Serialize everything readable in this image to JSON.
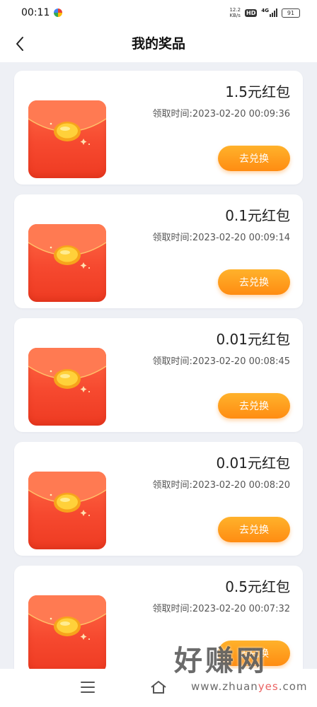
{
  "status_bar": {
    "time": "00:11",
    "net_speed_value": "12.2",
    "net_speed_unit": "KB/s",
    "hd": "HD",
    "network": "4G",
    "battery": "91"
  },
  "header": {
    "title": "我的奖品"
  },
  "prizes": [
    {
      "name": "1.5元红包",
      "time": "领取时间:2023-02-20 00:09:36",
      "action": "去兑换"
    },
    {
      "name": "0.1元红包",
      "time": "领取时间:2023-02-20 00:09:14",
      "action": "去兑换"
    },
    {
      "name": "0.01元红包",
      "time": "领取时间:2023-02-20 00:08:45",
      "action": "去兑换"
    },
    {
      "name": "0.01元红包",
      "time": "领取时间:2023-02-20 00:08:20",
      "action": "去兑换"
    },
    {
      "name": "0.5元红包",
      "time": "领取时间:2023-02-20 00:07:32",
      "action": "去兑换"
    }
  ],
  "watermark": {
    "title": "好赚网",
    "url_prefix": "www.zhuan",
    "url_highlight": "yes",
    "url_suffix": ".com"
  },
  "colors": {
    "page_background": "#eef0f5",
    "envelope_red": "#f6492f",
    "button_orange": "#ff9a1f"
  },
  "icons": [
    "back-arrow-icon",
    "menu-icon",
    "home-icon",
    "signal-icon",
    "battery-icon"
  ]
}
